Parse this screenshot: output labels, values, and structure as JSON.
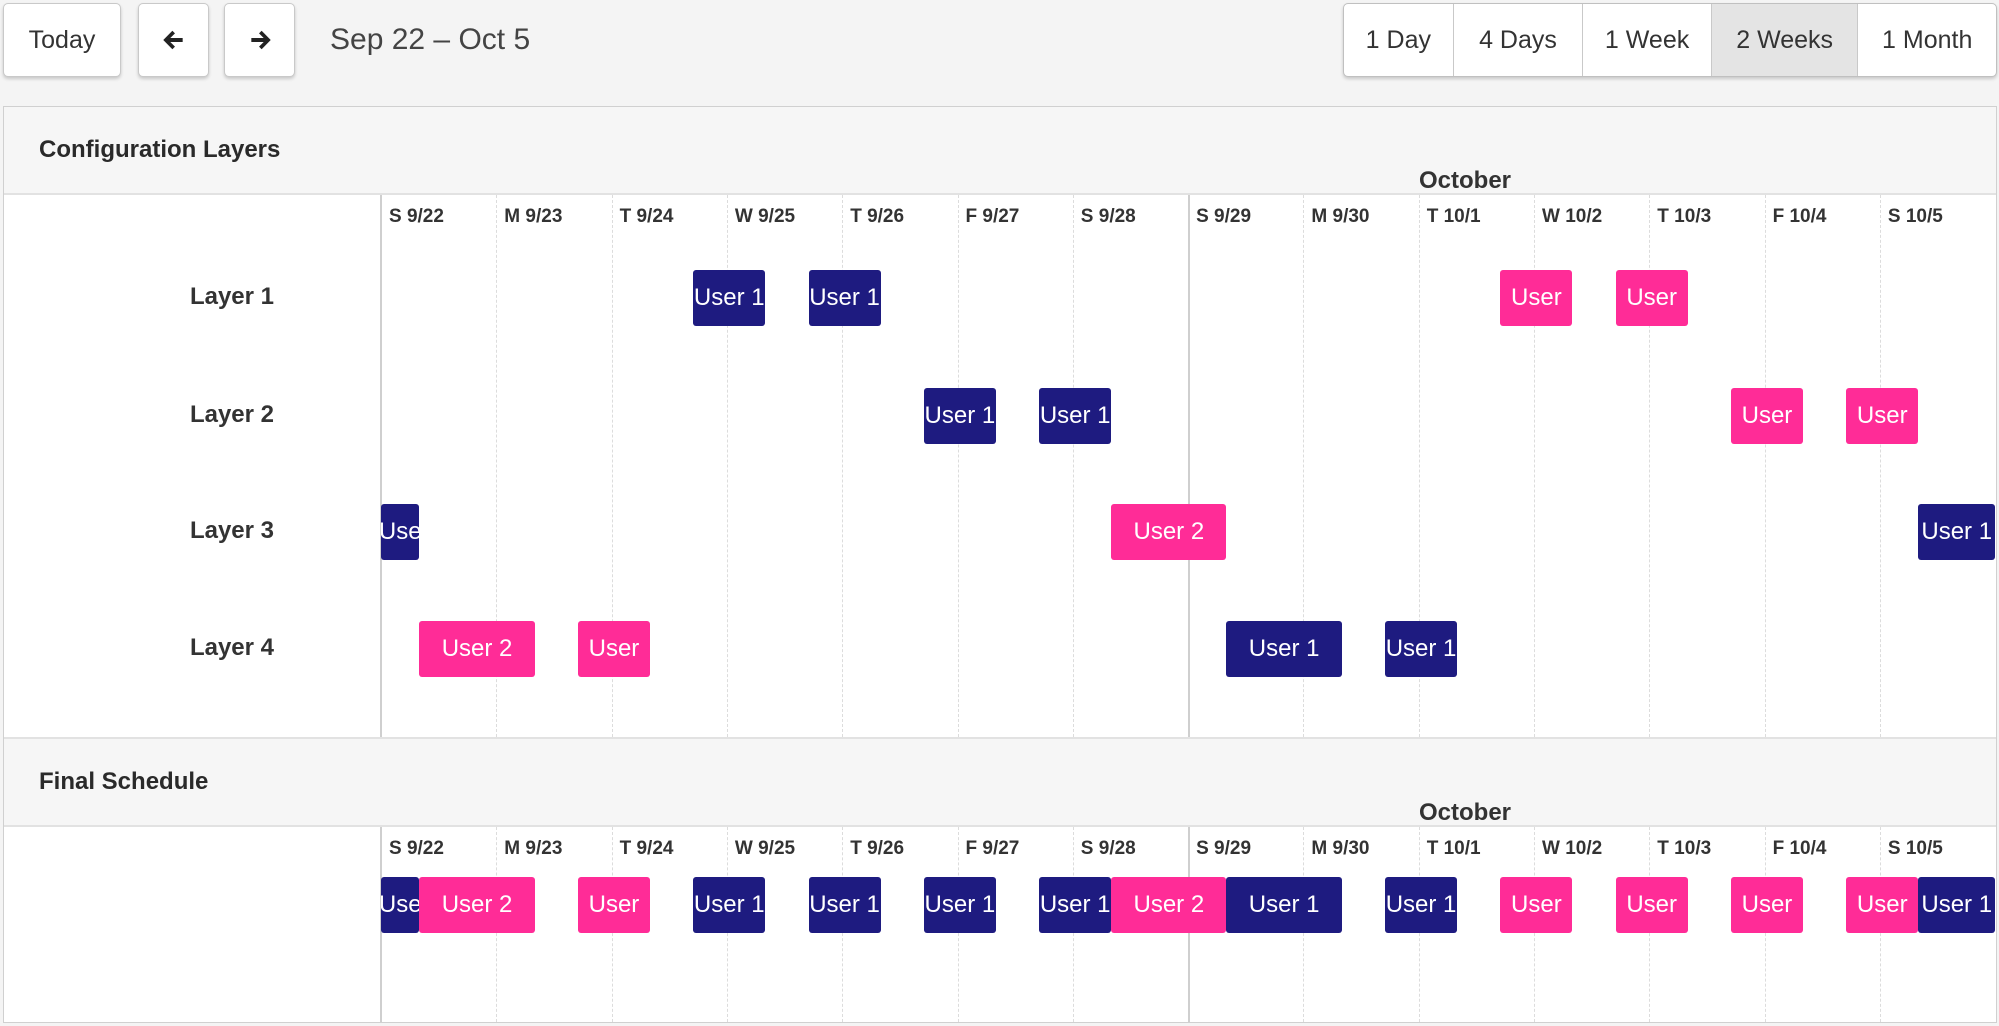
{
  "toolbar": {
    "today_label": "Today",
    "prev_icon": "arrow-left-icon",
    "next_icon": "arrow-right-icon",
    "range_label": "Sep 22 – Oct 5",
    "views": [
      {
        "label": "1 Day",
        "active": false
      },
      {
        "label": "4 Days",
        "active": false
      },
      {
        "label": "1 Week",
        "active": false
      },
      {
        "label": "2 Weeks",
        "active": true
      },
      {
        "label": "1 Month",
        "active": false
      }
    ]
  },
  "colors": {
    "user1": "#1e1b80",
    "user2": "#ff2c97"
  },
  "month_label": "October",
  "days": [
    "S 9/22",
    "M 9/23",
    "T 9/24",
    "W 9/25",
    "T 9/26",
    "F 9/27",
    "S 9/28",
    "S 9/29",
    "M 9/30",
    "T 10/1",
    "W 10/2",
    "T 10/3",
    "F 10/4",
    "S 10/5"
  ],
  "week_break_day_index": 7,
  "sections": {
    "config": {
      "title": "Configuration Layers",
      "layers": [
        {
          "label": "Layer 1",
          "events": [
            {
              "user": "user1",
              "label": "User 1",
              "start_day": 2.708,
              "end_day": 3.333
            },
            {
              "user": "user1",
              "label": "User 1",
              "start_day": 3.708,
              "end_day": 4.333
            },
            {
              "user": "user2",
              "label": "User",
              "start_day": 9.708,
              "end_day": 10.333
            },
            {
              "user": "user2",
              "label": "User",
              "start_day": 10.708,
              "end_day": 11.333
            }
          ]
        },
        {
          "label": "Layer 2",
          "events": [
            {
              "user": "user1",
              "label": "User 1",
              "start_day": 4.708,
              "end_day": 5.333
            },
            {
              "user": "user1",
              "label": "User 1",
              "start_day": 5.708,
              "end_day": 6.333
            },
            {
              "user": "user2",
              "label": "User",
              "start_day": 11.708,
              "end_day": 12.333
            },
            {
              "user": "user2",
              "label": "User",
              "start_day": 12.708,
              "end_day": 13.333
            }
          ]
        },
        {
          "label": "Layer 3",
          "events": [
            {
              "user": "user1",
              "label": "Use",
              "start_day": 0.0,
              "end_day": 0.333
            },
            {
              "user": "user2",
              "label": "User 2",
              "start_day": 6.333,
              "end_day": 7.333
            },
            {
              "user": "user1",
              "label": "User 1",
              "start_day": 13.333,
              "end_day": 14.0
            }
          ]
        },
        {
          "label": "Layer 4",
          "events": [
            {
              "user": "user2",
              "label": "User 2",
              "start_day": 0.333,
              "end_day": 1.333
            },
            {
              "user": "user2",
              "label": "User",
              "start_day": 1.708,
              "end_day": 2.333
            },
            {
              "user": "user1",
              "label": "User 1",
              "start_day": 7.333,
              "end_day": 8.333
            },
            {
              "user": "user1",
              "label": "User 1",
              "start_day": 8.708,
              "end_day": 9.333
            }
          ]
        }
      ]
    },
    "final": {
      "title": "Final Schedule",
      "events": [
        {
          "user": "user1",
          "label": "Use",
          "start_day": 0.0,
          "end_day": 0.333
        },
        {
          "user": "user2",
          "label": "User 2",
          "start_day": 0.333,
          "end_day": 1.333
        },
        {
          "user": "user2",
          "label": "User",
          "start_day": 1.708,
          "end_day": 2.333
        },
        {
          "user": "user1",
          "label": "User 1",
          "start_day": 2.708,
          "end_day": 3.333
        },
        {
          "user": "user1",
          "label": "User 1",
          "start_day": 3.708,
          "end_day": 4.333
        },
        {
          "user": "user1",
          "label": "User 1",
          "start_day": 4.708,
          "end_day": 5.333
        },
        {
          "user": "user1",
          "label": "User 1",
          "start_day": 5.708,
          "end_day": 6.333
        },
        {
          "user": "user2",
          "label": "User 2",
          "start_day": 6.333,
          "end_day": 7.333
        },
        {
          "user": "user1",
          "label": "User 1",
          "start_day": 7.333,
          "end_day": 8.333
        },
        {
          "user": "user1",
          "label": "User 1",
          "start_day": 8.708,
          "end_day": 9.333
        },
        {
          "user": "user2",
          "label": "User",
          "start_day": 9.708,
          "end_day": 10.333
        },
        {
          "user": "user2",
          "label": "User",
          "start_day": 10.708,
          "end_day": 11.333
        },
        {
          "user": "user2",
          "label": "User",
          "start_day": 11.708,
          "end_day": 12.333
        },
        {
          "user": "user2",
          "label": "User",
          "start_day": 12.708,
          "end_day": 13.333
        },
        {
          "user": "user1",
          "label": "User 1",
          "start_day": 13.333,
          "end_day": 14.0
        }
      ]
    }
  }
}
